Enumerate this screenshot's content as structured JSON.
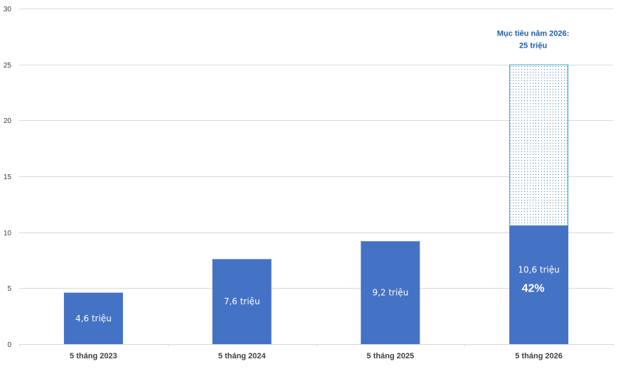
{
  "chart_data": {
    "type": "bar",
    "title": "",
    "xlabel": "",
    "ylabel": "",
    "ylim": [
      0,
      30
    ],
    "yticks": [
      0,
      5,
      10,
      15,
      20,
      25,
      30
    ],
    "grid": true,
    "categories": [
      "5 tháng 2023",
      "5 tháng 2024",
      "5 tháng 2025",
      "5 tháng 2026"
    ],
    "values": [
      4.6,
      7.6,
      9.2,
      10.6
    ],
    "data_labels": [
      "4,6 triệu",
      "7,6 triệu",
      "9,2 triệu",
      "10,6 triệu"
    ],
    "target": {
      "value": 25,
      "category_index": 3,
      "label_line1": "Mục tiêu năm 2026:",
      "label_line2": "25 triệu",
      "progress_label": "42%"
    },
    "colors": {
      "bar": "#4472c4",
      "target_outline": "#2fa8c8",
      "target_dots": "#3d7fb8",
      "target_text": "#1f5fa8",
      "grid": "#d9d9d9"
    }
  }
}
